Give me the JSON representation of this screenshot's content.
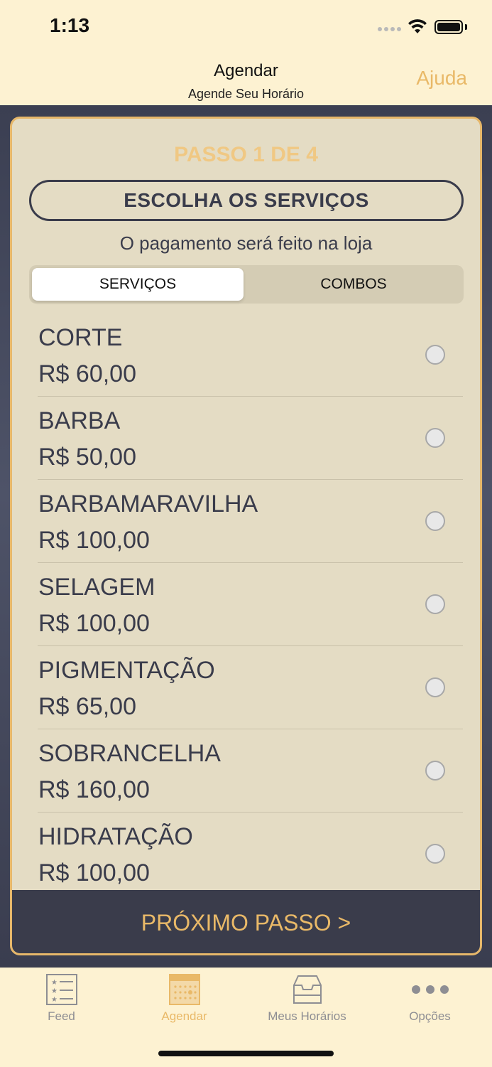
{
  "status": {
    "time": "1:13"
  },
  "nav": {
    "title": "Agendar",
    "subtitle": "Agende Seu Horário",
    "help": "Ajuda"
  },
  "card": {
    "step": "PASSO 1 DE 4",
    "choose": "ESCOLHA OS SERVIÇOS",
    "payment_note": "O pagamento será feito na loja",
    "segments": {
      "services": "SERVIÇOS",
      "combos": "COMBOS",
      "selected": "SERVIÇOS"
    },
    "services": [
      {
        "name": "CORTE",
        "price": "R$ 60,00"
      },
      {
        "name": "BARBA",
        "price": "R$ 50,00"
      },
      {
        "name": "BARBAMARAVILHA",
        "price": "R$ 100,00"
      },
      {
        "name": "SELAGEM",
        "price": "R$ 100,00"
      },
      {
        "name": "PIGMENTAÇÃO",
        "price": "R$ 65,00"
      },
      {
        "name": "SOBRANCELHA",
        "price": "R$ 160,00"
      },
      {
        "name": "HIDRATAÇÃO",
        "price": "R$ 100,00"
      }
    ],
    "next": "PRÓXIMO PASSO >"
  },
  "tabs": [
    {
      "label": "Feed",
      "icon": "feed-list-icon"
    },
    {
      "label": "Agendar",
      "icon": "calendar-icon",
      "active": true
    },
    {
      "label": "Meus Horários",
      "icon": "inbox-icon"
    },
    {
      "label": "Opções",
      "icon": "more-dots-icon"
    }
  ],
  "colors": {
    "accent": "#e9b968",
    "dark": "#3a3c4b",
    "card": "#e4dcc4",
    "background": "#fdf2d2"
  }
}
